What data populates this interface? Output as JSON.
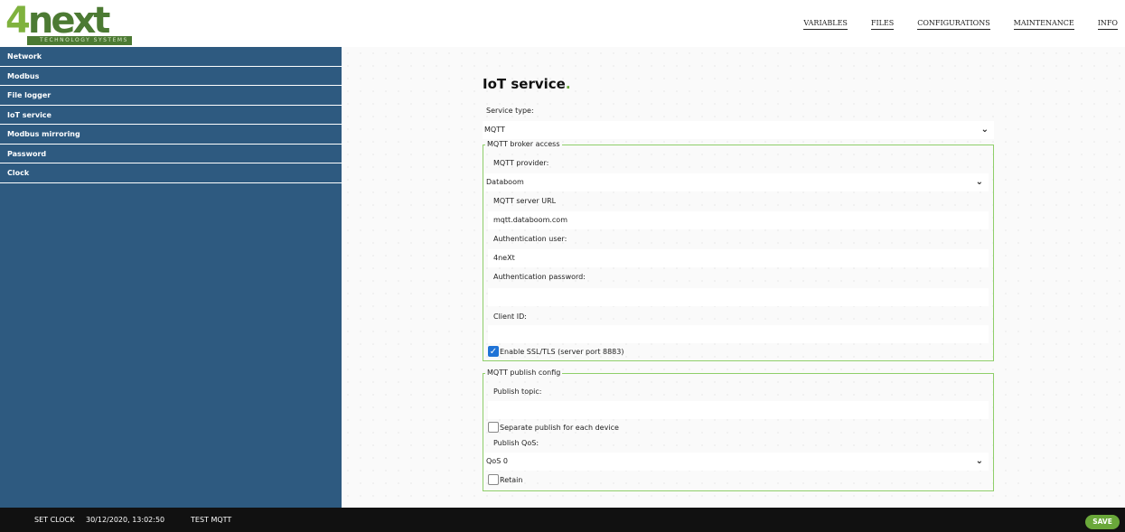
{
  "brand": {
    "logo_text": "4next",
    "tagline": "TECHNOLOGY SYSTEMS"
  },
  "topnav": [
    "VARIABLES",
    "FILES",
    "CONFIGURATIONS",
    "MAINTENANCE",
    "INFO"
  ],
  "sidebar": {
    "items": [
      {
        "label": "Network"
      },
      {
        "label": "Modbus"
      },
      {
        "label": "File logger"
      },
      {
        "label": "IoT service"
      },
      {
        "label": "Modbus mirroring"
      },
      {
        "label": "Password"
      },
      {
        "label": "Clock"
      }
    ]
  },
  "page": {
    "title": "IoT service",
    "title_dot": "."
  },
  "service": {
    "type_label": "Service type:",
    "type_value": "MQTT"
  },
  "broker": {
    "legend": "MQTT broker access",
    "provider_label": "MQTT provider:",
    "provider_value": "Databoom",
    "url_label": "MQTT server URL",
    "url_value": "mqtt.databoom.com",
    "user_label": "Authentication user:",
    "user_value": "4neXt",
    "password_label": "Authentication password:",
    "password_value": "",
    "client_label": "Client ID:",
    "client_value": "",
    "ssl_label": "Enable SSL/TLS (server port 8883)",
    "ssl_checked": true
  },
  "publish": {
    "legend": "MQTT publish config",
    "topic_label": "Publish topic:",
    "topic_value": "",
    "separate_label": "Separate publish for each device",
    "separate_checked": false,
    "qos_label": "Publish QoS:",
    "qos_value": "QoS 0",
    "retain_label": "Retain",
    "retain_checked": false
  },
  "footer": {
    "set_clock": "SET CLOCK",
    "datetime": "30/12/2020, 13:02:50",
    "test_mqtt": "TEST MQTT",
    "save": "SAVE"
  },
  "colors": {
    "sidebar": "#2e5a80",
    "accent": "#6aa83a",
    "fieldset_border": "#8fcf6a",
    "footer": "#111111"
  }
}
